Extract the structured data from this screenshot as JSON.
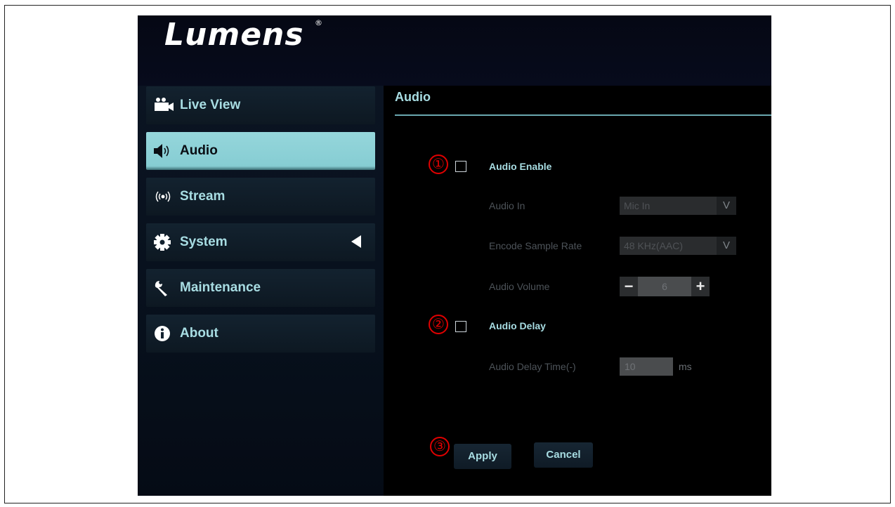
{
  "brand": {
    "logo_text": "Lumens",
    "registered_mark": "®"
  },
  "sidebar": {
    "items": [
      {
        "label": "Live View",
        "icon": "video-camera-icon",
        "active": false
      },
      {
        "label": "Audio",
        "icon": "speaker-icon",
        "active": true
      },
      {
        "label": "Stream",
        "icon": "broadcast-icon",
        "active": false
      },
      {
        "label": "System",
        "icon": "gear-icon",
        "active": false,
        "expand_indicator": "left-arrow"
      },
      {
        "label": "Maintenance",
        "icon": "wrench-icon",
        "active": false
      },
      {
        "label": "About",
        "icon": "info-icon",
        "active": false
      }
    ]
  },
  "main": {
    "title": "Audio",
    "markers": [
      "①",
      "②",
      "③"
    ],
    "audio_enable": {
      "label": "Audio Enable",
      "checked": false
    },
    "audio_in": {
      "label": "Audio In",
      "value": "Mic In",
      "arrow": "V"
    },
    "encode_sample_rate": {
      "label": "Encode Sample Rate",
      "value": "48 KHz(AAC)",
      "arrow": "V"
    },
    "audio_volume": {
      "label": "Audio Volume",
      "value": "6",
      "minus": "−",
      "plus": "+"
    },
    "audio_delay": {
      "label": "Audio Delay",
      "checked": false
    },
    "audio_delay_time": {
      "label": "Audio Delay Time(-)",
      "value": "10",
      "unit": "ms"
    },
    "buttons": {
      "apply": "Apply",
      "cancel": "Cancel"
    }
  },
  "colors": {
    "accent": "#a8dde3",
    "active_tab": "#8ed3d8",
    "marker_red": "#e00000",
    "background": "#000000"
  }
}
